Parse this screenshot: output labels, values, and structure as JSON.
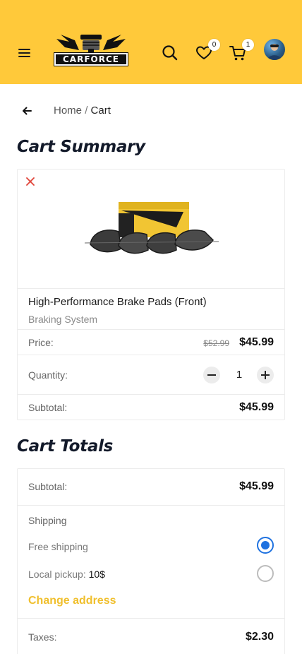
{
  "header": {
    "brand": "CARFORCE",
    "wishlist_count": "0",
    "cart_count": "1",
    "colors": {
      "bar": "#ffc93a",
      "accent": "#f0bf2c",
      "radio": "#1f72e0"
    },
    "icons": [
      "menu-icon",
      "search-icon",
      "heart-icon",
      "cart-icon",
      "avatar"
    ]
  },
  "breadcrumb": {
    "home": "Home",
    "separator": "/",
    "current": "Cart"
  },
  "cart_summary": {
    "title": "Cart Summary",
    "item": {
      "name": "High-Performance Brake Pads (Front)",
      "category": "Braking System",
      "price_label": "Price:",
      "old_price": "$52.99",
      "price": "$45.99",
      "quantity_label": "Quantity:",
      "quantity": "1",
      "subtotal_label": "Subtotal:",
      "subtotal": "$45.99"
    }
  },
  "cart_totals": {
    "title": "Cart Totals",
    "subtotal_label": "Subtotal:",
    "subtotal": "$45.99",
    "shipping_label": "Shipping",
    "options": [
      {
        "label": "Free shipping",
        "price": "",
        "selected": true
      },
      {
        "label": "Local pickup:",
        "price": "10$",
        "selected": false
      }
    ],
    "change_address": "Change address",
    "taxes_label": "Taxes:",
    "taxes": "$2.30"
  }
}
